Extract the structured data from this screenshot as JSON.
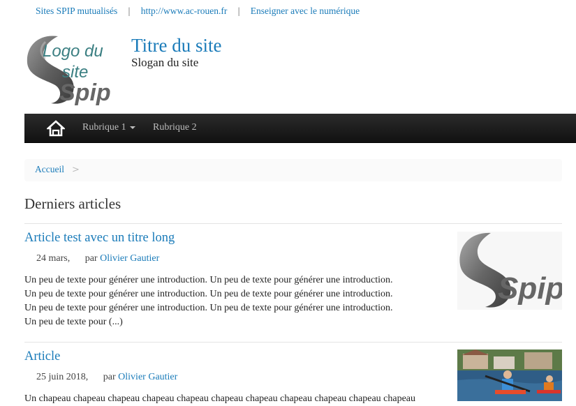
{
  "top_links": [
    "Sites SPIP mutualisés",
    "http://www.ac-rouen.fr",
    "Enseigner avec le numérique"
  ],
  "top_link_separator": "|",
  "site": {
    "logo_text": [
      "Logo du",
      "site",
      "Spip"
    ],
    "title": "Titre du site",
    "slogan": "Slogan du site"
  },
  "nav": {
    "home_icon": "home-icon",
    "items": [
      "Rubrique 1",
      "Rubrique 2"
    ]
  },
  "breadcrumb": {
    "home": "Accueil",
    "divider": ">"
  },
  "section_title": "Derniers articles",
  "articles": [
    {
      "title": "Article test avec un titre long",
      "date": "24 mars,",
      "by_label": "par",
      "author": "Olivier Gautier",
      "intro_lines": [
        "Un peu de texte pour générer une introduction. Un peu de texte pour générer une introduction.",
        "Un peu de texte pour générer une introduction. Un peu de texte pour générer une introduction.",
        "Un peu de texte pour générer une introduction. Un peu de texte pour générer une introduction.",
        "Un peu de texte pour (...)"
      ],
      "thumb_text": "Spip"
    },
    {
      "title": "Article",
      "date": "25 juin 2018,",
      "by_label": "par",
      "author": "Olivier Gautier",
      "intro_lines": [
        "Un chapeau chapeau chapeau chapeau chapeau chapeau chapeau chapeau chapeau chapeau chapeau"
      ]
    }
  ],
  "colors": {
    "link": "#1a7bb9",
    "navbar": "#1c1c1c",
    "nav_text": "#bdbdbd"
  }
}
